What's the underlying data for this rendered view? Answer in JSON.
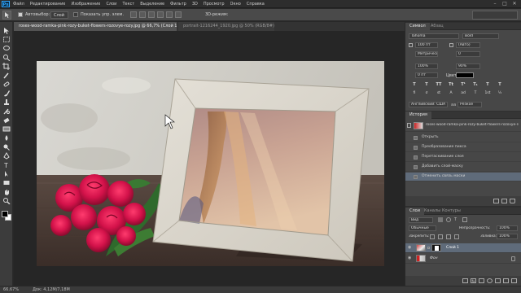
{
  "app": {
    "logo": "Ps"
  },
  "menubar": {
    "items": [
      "Файл",
      "Редактирование",
      "Изображение",
      "Слои",
      "Текст",
      "Выделение",
      "Фильтр",
      "3D",
      "Просмотр",
      "Окно",
      "Справка"
    ]
  },
  "window_controls": {
    "minimize": "–",
    "maximize": "□",
    "close": "✕"
  },
  "options": {
    "autoselect_label": "Автовыбор:",
    "autoselect_value": "Слой",
    "show_controls_label": "Показать упр. элем.",
    "mode_3d": "3D-режим:"
  },
  "tabs": [
    {
      "label": "roses-wood-ramka-pink-rozy-buket-flowers-rozovye-rozy.jpg @ 66,7% (Слой 1, RGB/8#) *",
      "active": true
    },
    {
      "label": "portrait-1216244_1920.jpg @ 50% (RGB/8#) *",
      "active": false
    }
  ],
  "tools": [
    "move-icon",
    "marquee-icon",
    "lasso-icon",
    "quick-select-icon",
    "crop-icon",
    "eyedropper-icon",
    "healing-icon",
    "brush-icon",
    "clone-stamp-icon",
    "history-brush-icon",
    "eraser-icon",
    "gradient-icon",
    "blur-icon",
    "dodge-icon",
    "pen-icon",
    "type-icon",
    "path-select-icon",
    "rectangle-icon",
    "hand-icon",
    "zoom-icon"
  ],
  "status": {
    "zoom": "66,67%",
    "doc_size": "Док: 4,12М/7,18М"
  },
  "character_panel": {
    "tabs": [
      "Символ",
      "Абзац"
    ],
    "font_family": "Tahoma",
    "font_style": "Bold",
    "font_size": "100 пт",
    "leading": "(Авто)",
    "kerning": "Метрические",
    "tracking": "0",
    "vscale": "100%",
    "hscale": "90%",
    "baseline": "0 пт",
    "color_label": "Цвет:",
    "color_value": "#000000",
    "type_buttons": [
      "T",
      "T",
      "TT",
      "Tt",
      "T¹",
      "T₁",
      "T",
      "T"
    ],
    "extra_buttons": [
      "fi",
      "σ",
      "st",
      "A",
      "ad",
      "T",
      "1st",
      "½"
    ],
    "language": "Английский: США",
    "aa_label": "aa",
    "aa_value": "Резкое"
  },
  "history_panel": {
    "title": "История",
    "snapshot_label": "roses-wood-ramka-pink-rozy-buket-flowers-rozovye-ro...",
    "items": [
      "Открыть",
      "Преобразование пикса",
      "Перетаскивание слоя",
      "Добавить слой-маску",
      "Отменить связь маски"
    ],
    "selected_index": 4
  },
  "layers_panel": {
    "tabs": [
      "Слои",
      "Каналы",
      "Контуры"
    ],
    "filter": "Вид",
    "blend_mode": "Обычные",
    "opacity_label": "Непрозрачность:",
    "opacity": "100%",
    "lock_label": "Закрепить:",
    "fill_label": "Заливка:",
    "fill": "100%",
    "layers": [
      {
        "name": "Слой 1",
        "selected": true
      },
      {
        "name": "Фон",
        "selected": false
      }
    ]
  }
}
